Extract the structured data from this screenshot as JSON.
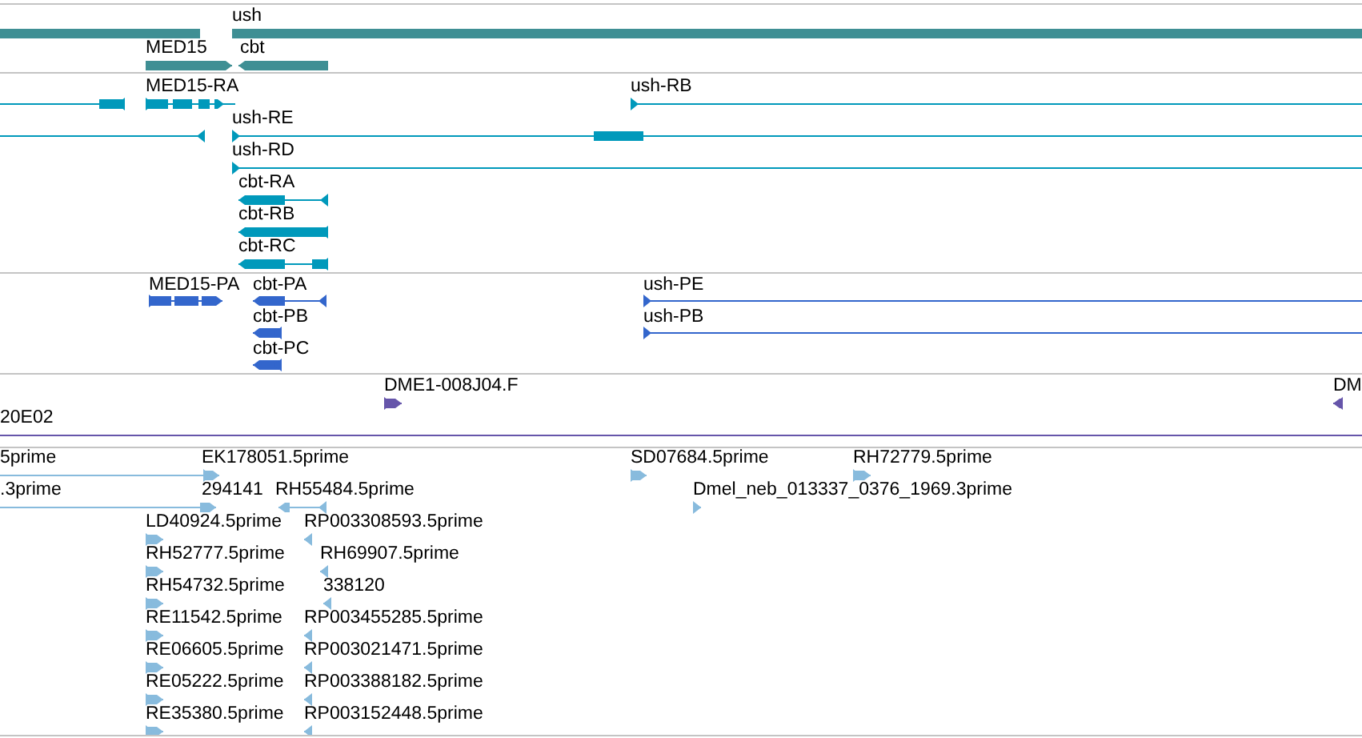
{
  "tracks": [
    {
      "kind": "gene",
      "features": [
        {
          "reverse": true
        },
        {
          "label": "ush",
          "reverse": false
        },
        {
          "label": "MED15",
          "reverse": false
        },
        {
          "label": "cbt",
          "reverse": true
        }
      ]
    },
    {
      "kind": "transcript",
      "features": [
        {
          "reverse": true
        },
        {
          "label": "MED15-RA",
          "reverse": false
        },
        {
          "label": "ush-RB",
          "reverse": false
        },
        {
          "reverse": true
        },
        {
          "label": "ush-RE",
          "reverse": false
        },
        {
          "label": "ush-RD",
          "reverse": false
        },
        {
          "label": "cbt-RA",
          "reverse": true
        },
        {
          "label": "cbt-RB",
          "reverse": true
        },
        {
          "label": "cbt-RC",
          "reverse": true
        }
      ]
    },
    {
      "kind": "protein",
      "features": [
        {
          "label": "MED15-PA",
          "reverse": false
        },
        {
          "label": "cbt-PA",
          "reverse": true
        },
        {
          "label": "ush-PE",
          "reverse": false
        },
        {
          "label": "cbt-PB",
          "reverse": true
        },
        {
          "label": "ush-PB",
          "reverse": false
        },
        {
          "label": "cbt-PC",
          "reverse": true
        }
      ]
    },
    {
      "kind": "clone",
      "features": [
        {
          "label": "DME1-008J04.F",
          "reverse": false
        },
        {
          "label": "DM",
          "reverse": true
        },
        {
          "label": "20E02"
        }
      ]
    },
    {
      "kind": "est",
      "features": [
        {
          "label": "5prime",
          "reverse": false
        },
        {
          "label": "EK178051.5prime",
          "reverse": false
        },
        {
          "label": "SD07684.5prime",
          "reverse": false
        },
        {
          "label": "RH72779.5prime",
          "reverse": false
        },
        {
          "label": ".3prime",
          "reverse": false
        },
        {
          "label": "294141"
        },
        {
          "label": "RH55484.5prime",
          "reverse": true
        },
        {
          "label": "Dmel_neb_013337_0376_1969.3prime",
          "reverse": false
        },
        {
          "label": "LD40924.5prime",
          "reverse": false
        },
        {
          "label": "RP003308593.5prime",
          "reverse": true
        },
        {
          "label": "RH52777.5prime",
          "reverse": false
        },
        {
          "label": "RH69907.5prime",
          "reverse": true
        },
        {
          "label": "RH54732.5prime",
          "reverse": false
        },
        {
          "label": "338120",
          "reverse": true
        },
        {
          "label": "RE11542.5prime",
          "reverse": false
        },
        {
          "label": "RP003455285.5prime",
          "reverse": true
        },
        {
          "label": "RE06605.5prime",
          "reverse": false
        },
        {
          "label": "RP003021471.5prime",
          "reverse": true
        },
        {
          "label": "RE05222.5prime",
          "reverse": false
        },
        {
          "label": "RP003388182.5prime",
          "reverse": true
        },
        {
          "label": "RE35380.5prime",
          "reverse": false
        },
        {
          "label": "RP003152448.5prime",
          "reverse": true
        }
      ]
    }
  ]
}
